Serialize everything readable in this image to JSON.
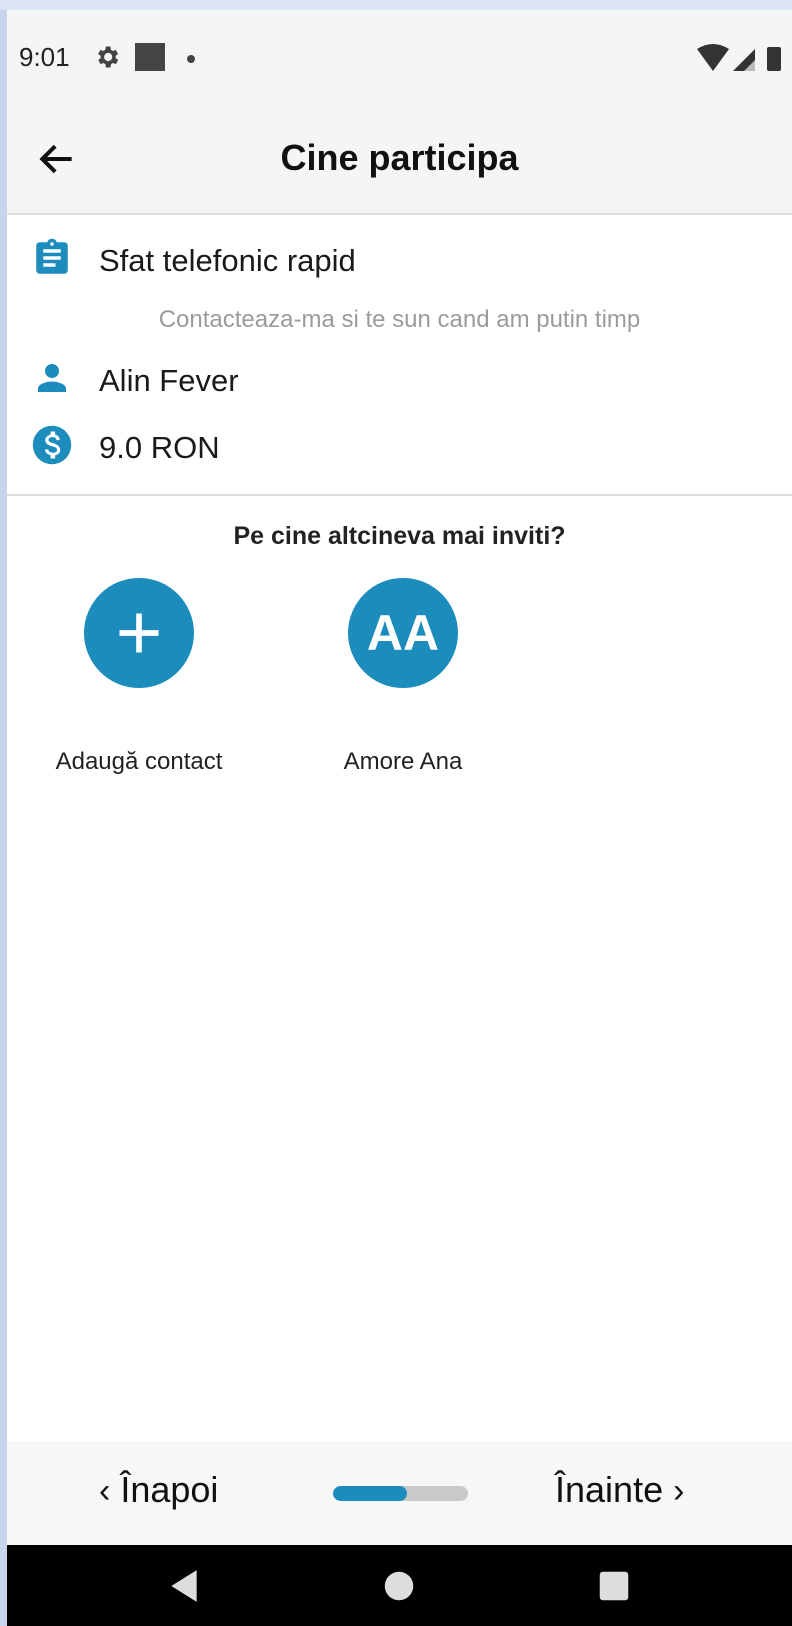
{
  "status_bar": {
    "time": "9:01",
    "icons": [
      "gear-icon",
      "square-icon",
      "dot-icon",
      "wifi-icon",
      "signal-icon",
      "battery-icon"
    ]
  },
  "app_bar": {
    "title": "Cine participa",
    "back_icon": "arrow-left-icon"
  },
  "service": {
    "name": "Sfat telefonic rapid",
    "description": "Contacteaza-ma si te sun cand am putin timp",
    "provider": "Alin Fever",
    "price": "9.0 RON",
    "icons": {
      "service": "clipboard-icon",
      "provider": "person-icon",
      "price": "dollar-icon"
    }
  },
  "invite": {
    "title": "Pe cine altcineva mai inviti?",
    "add_label": "Adaugă contact",
    "contacts": [
      {
        "initials": "AA",
        "name": "Amore Ana"
      }
    ]
  },
  "bottom_nav": {
    "prev_label": "Înapoi",
    "next_label": "Înainte",
    "progress": 0.55
  },
  "colors": {
    "accent": "#1c8cbd",
    "track": "#c9c9c9",
    "subtitle": "#9b9b9b"
  }
}
